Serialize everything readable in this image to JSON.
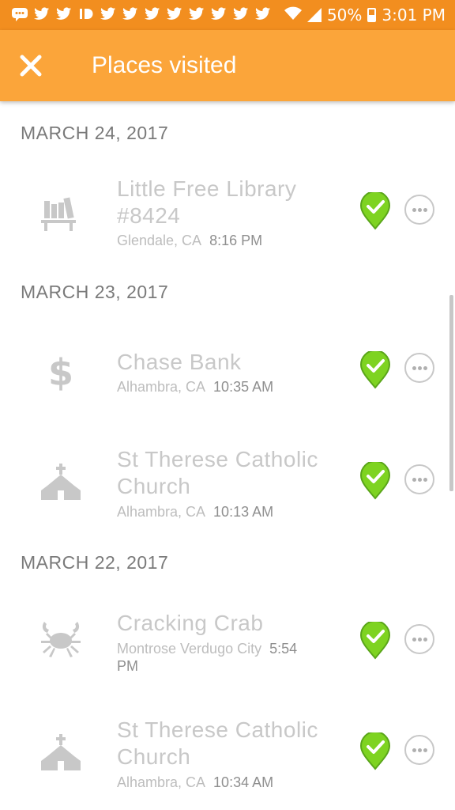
{
  "status_bar": {
    "battery": "50%",
    "time": "3:01 PM",
    "notification_icons": [
      "message-icon",
      "twitter-icon",
      "twitter-icon",
      "id-icon",
      "twitter-icon",
      "twitter-icon",
      "twitter-icon",
      "twitter-icon",
      "twitter-icon",
      "twitter-icon",
      "twitter-icon"
    ]
  },
  "app_bar": {
    "title": "Places visited"
  },
  "sections": [
    {
      "date": "MARCH 24, 2017",
      "places": [
        {
          "name_line1": "Little Free Library",
          "name_line2": "#8424",
          "city": "Glendale, CA",
          "time": "8:16 PM",
          "icon": "library-icon"
        }
      ]
    },
    {
      "date": "MARCH 23, 2017",
      "places": [
        {
          "name_line1": "Chase Bank",
          "name_line2": "",
          "city": "Alhambra, CA",
          "time": "10:35 AM",
          "icon": "dollar-icon"
        },
        {
          "name_line1": "St Therese Catholic",
          "name_line2": "Church",
          "city": "Alhambra, CA",
          "time": "10:13 AM",
          "icon": "church-icon"
        }
      ]
    },
    {
      "date": "MARCH 22, 2017",
      "places": [
        {
          "name_line1": "Cracking Crab",
          "name_line2": "",
          "city": "Montrose Verdugo City",
          "time": "5:54",
          "time_line2": "PM",
          "icon": "crab-icon"
        },
        {
          "name_line1": "St Therese Catholic",
          "name_line2": "Church",
          "city": "Alhambra, CA",
          "time": "10:34 AM",
          "icon": "church-icon"
        }
      ]
    }
  ],
  "colors": {
    "status_bar": "#f28e1f",
    "app_bar": "#fba53a",
    "visited_pin": "#7ed321",
    "place_name": "#c8c8c8",
    "date_header": "#7a7a7a"
  }
}
